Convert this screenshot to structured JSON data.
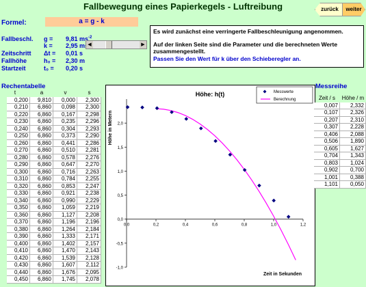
{
  "title": "Fallbewegung eines Papierkegels - Luftreibung",
  "nav": {
    "back_label": "zurück",
    "next_label": "weiter"
  },
  "formel": {
    "label": "Formel:",
    "value": "a = g - k"
  },
  "params": [
    {
      "label": "Fallbeschl.",
      "symbol": "g =",
      "value": "9,81 ms",
      "sup": "-2"
    },
    {
      "label": "",
      "symbol": "k =",
      "value": "2,95 ms",
      "sup": "-2"
    },
    {
      "label": "Zeitschritt",
      "symbol": "Δt =",
      "value": "0,01 s",
      "sup": ""
    },
    {
      "label": "Fallhöhe",
      "symbol": "h₀ =",
      "value": "2,30 m",
      "sup": ""
    },
    {
      "label": "Startzeit",
      "symbol": "t₀ =",
      "value": "0,20 s",
      "sup": ""
    }
  ],
  "slider": {
    "value": 2.95
  },
  "info": {
    "line1": "Es wird zunächst eine verringerte Fallbeschleunigung angenommen.",
    "line2": "Auf der linken Seite sind die Parameter und die berechneten Werte zusammengestellt.",
    "line3": "Passen Sie den Wert für k über den Schieberegler an."
  },
  "rechentabelle": {
    "title": "Rechentabelle",
    "headers": [
      "t",
      "a",
      "v",
      "s"
    ],
    "rows": [
      [
        "0,200",
        "9,810",
        "0,000",
        "2,300"
      ],
      [
        "0,210",
        "6,860",
        "0,098",
        "2,300"
      ],
      [
        "0,220",
        "6,860",
        "0,167",
        "2,298"
      ],
      [
        "0,230",
        "6,860",
        "0,235",
        "2,296"
      ],
      [
        "0,240",
        "6,860",
        "0,304",
        "2,293"
      ],
      [
        "0,250",
        "6,860",
        "0,373",
        "2,290"
      ],
      [
        "0,260",
        "6,860",
        "0,441",
        "2,286"
      ],
      [
        "0,270",
        "6,860",
        "0,510",
        "2,281"
      ],
      [
        "0,280",
        "6,860",
        "0,578",
        "2,276"
      ],
      [
        "0,290",
        "6,860",
        "0,647",
        "2,270"
      ],
      [
        "0,300",
        "6,860",
        "0,716",
        "2,263"
      ],
      [
        "0,310",
        "6,860",
        "0,784",
        "2,255"
      ],
      [
        "0,320",
        "6,860",
        "0,853",
        "2,247"
      ],
      [
        "0,330",
        "6,860",
        "0,921",
        "2,238"
      ],
      [
        "0,340",
        "6,860",
        "0,990",
        "2,229"
      ],
      [
        "0,350",
        "6,860",
        "1,059",
        "2,219"
      ],
      [
        "0,360",
        "6,860",
        "1,127",
        "2,208"
      ],
      [
        "0,370",
        "6,860",
        "1,196",
        "2,196"
      ],
      [
        "0,380",
        "6,860",
        "1,264",
        "2,184"
      ],
      [
        "0,390",
        "6,860",
        "1,333",
        "2,171"
      ],
      [
        "0,400",
        "6,860",
        "1,402",
        "2,157"
      ],
      [
        "0,410",
        "6,860",
        "1,470",
        "2,143"
      ],
      [
        "0,420",
        "6,860",
        "1,539",
        "2,128"
      ],
      [
        "0,430",
        "6,860",
        "1,607",
        "2,112"
      ],
      [
        "0,440",
        "6,860",
        "1,676",
        "2,095"
      ],
      [
        "0,450",
        "6,860",
        "1,745",
        "2,078"
      ]
    ]
  },
  "messreihe": {
    "title": "Messreihe",
    "headers": [
      "Zeit / s",
      "Höhe / m"
    ],
    "rows": [
      [
        "0,007",
        "2,332"
      ],
      [
        "0,107",
        "2,326"
      ],
      [
        "0,207",
        "2,310"
      ],
      [
        "0,307",
        "2,228"
      ],
      [
        "0,406",
        "2,088"
      ],
      [
        "0,506",
        "1,890"
      ],
      [
        "0,605",
        "1,627"
      ],
      [
        "0,704",
        "1,343"
      ],
      [
        "0,803",
        "1,024"
      ],
      [
        "0,902",
        "0,700"
      ],
      [
        "1,001",
        "0,388"
      ],
      [
        "1,101",
        "0,050"
      ]
    ]
  },
  "chart_data": {
    "type": "scatter",
    "title": "Höhe: h(t)",
    "xlabel": "Zeit in Sekunden",
    "ylabel": "Höhe in Metern",
    "xlim": [
      0,
      1.2
    ],
    "ylim": [
      -1.0,
      2.5
    ],
    "xticks": [
      "0,0",
      "0,2",
      "0,4",
      "0,6",
      "0,8",
      "1,0",
      "1,2"
    ],
    "yticks": [
      "-1,0",
      "-0,5",
      "0,0",
      "0,5",
      "1,0",
      "1,5",
      "2,0"
    ],
    "legend_position": "top-right",
    "grid": false,
    "series": [
      {
        "name": "Messwerte",
        "kind": "points",
        "color": "#000080",
        "x": [
          0.007,
          0.107,
          0.207,
          0.307,
          0.406,
          0.506,
          0.605,
          0.704,
          0.803,
          0.902,
          1.001,
          1.101
        ],
        "y": [
          2.332,
          2.326,
          2.31,
          2.228,
          2.088,
          1.89,
          1.627,
          1.343,
          1.024,
          0.7,
          0.388,
          0.05
        ]
      },
      {
        "name": "Berechnung",
        "kind": "line",
        "color": "#ff00ff",
        "x": [
          0.2,
          0.25,
          0.3,
          0.35,
          0.4,
          0.45,
          0.5,
          0.55,
          0.6,
          0.65,
          0.7,
          0.75,
          0.8,
          0.85,
          0.9,
          0.95,
          1.0,
          1.05,
          1.1,
          1.15
        ],
        "y": [
          2.3,
          2.29,
          2.263,
          2.219,
          2.157,
          2.078,
          1.981,
          1.867,
          1.736,
          1.587,
          1.421,
          1.238,
          1.037,
          0.819,
          0.584,
          0.331,
          0.062,
          -0.225,
          -0.529,
          -0.85
        ]
      }
    ]
  }
}
